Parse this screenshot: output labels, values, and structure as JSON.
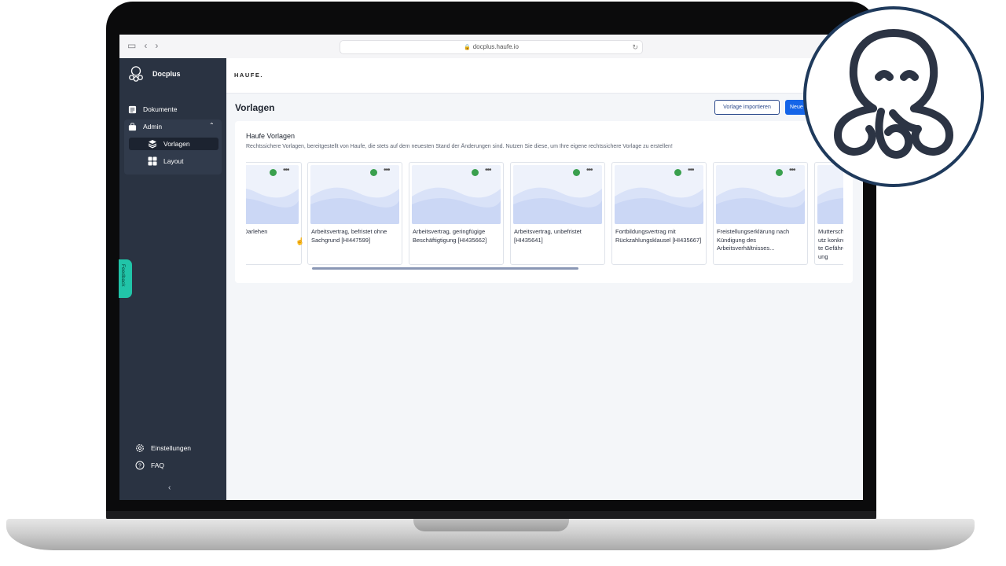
{
  "browser": {
    "url": "docplus.haufe.io"
  },
  "sidebar": {
    "brand": "Docplus",
    "items": [
      {
        "label": "Dokumente"
      },
      {
        "label": "Admin"
      },
      {
        "label": "Vorlagen"
      },
      {
        "label": "Layout"
      }
    ],
    "footer": [
      {
        "label": "Einstellungen"
      },
      {
        "label": "FAQ"
      }
    ]
  },
  "topbar": {
    "logo": "HAUFE."
  },
  "page": {
    "title": "Vorlagen",
    "import_button": "Vorlage importieren",
    "new_button": "Neue"
  },
  "panel": {
    "title": "Haufe Vorlagen",
    "description": "Rechtssichere Vorlagen, bereitgestellt von Haufe, die stets auf dem neuesten Stand der Änderungen sind. Nutzen Sie diese, um Ihre eigene rechtssichere Vorlage zu erstellen!",
    "cards": [
      {
        "title": "Darlehen"
      },
      {
        "title": "Arbeitsvertrag, befristet ohne Sachgrund [HI447599]"
      },
      {
        "title": "Arbeitsvertrag, geringfügige Beschäftigtigung [HI435662]"
      },
      {
        "title": "Arbeitsvertrag, unbefristet [HI435641]"
      },
      {
        "title": "Fortbildungsvertrag mit Rückzahlungsklausel [HI435667]"
      },
      {
        "title": "Freistellungserklärung nach Kündigung des Arbeitsverhältnisses..."
      },
      {
        "title": "Mutterschutz konkrete Gefährdung"
      }
    ]
  },
  "feedback": {
    "label": "Feedback"
  },
  "colors": {
    "sidebar": "#2a3342",
    "primary": "#1565e8",
    "badge_ring": "#1f3a5c",
    "feedback": "#21c4a8"
  }
}
